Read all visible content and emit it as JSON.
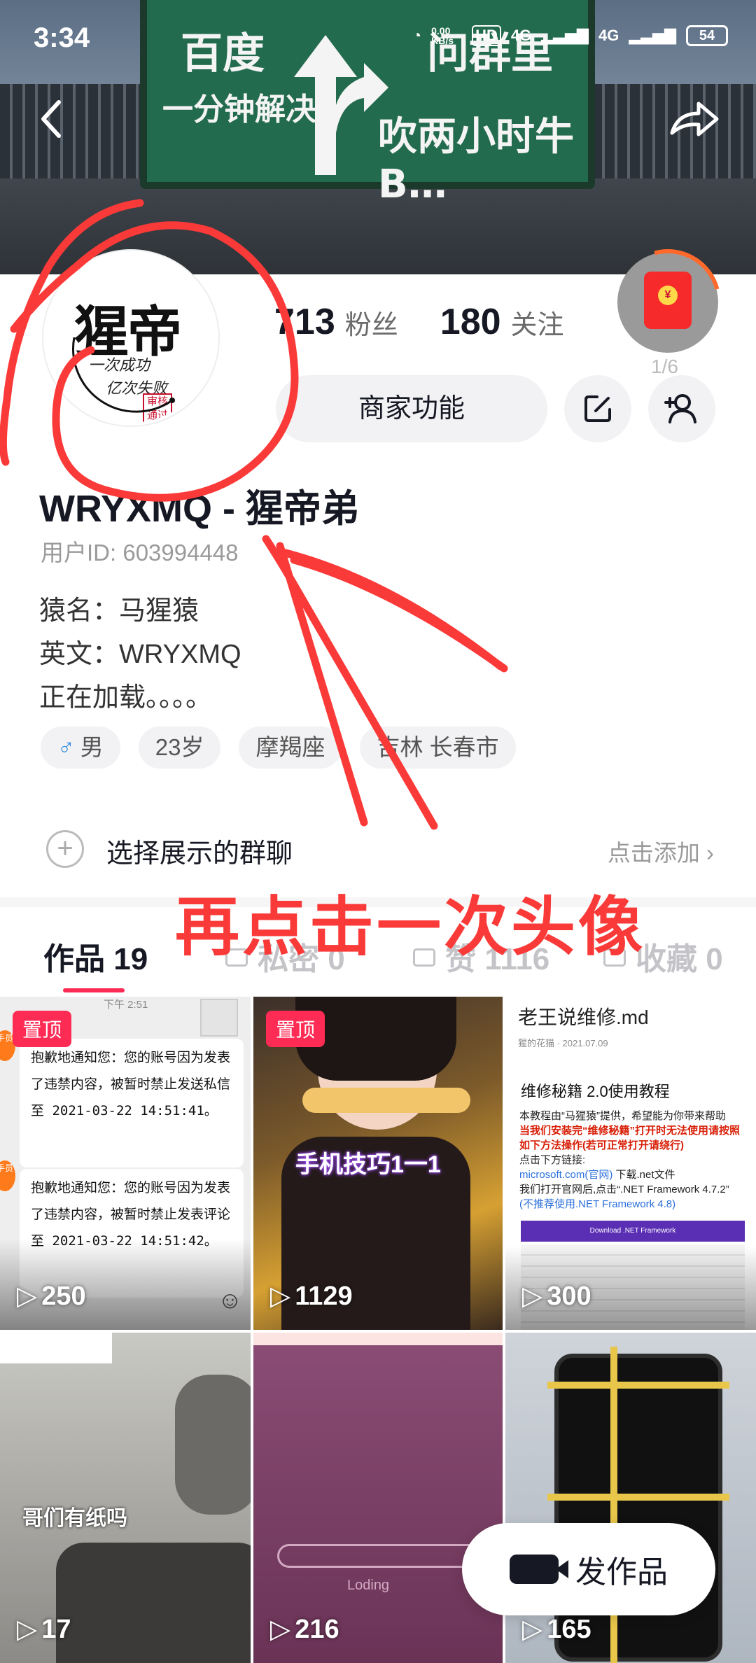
{
  "status_bar": {
    "time": "3:34",
    "net_speed": "0.00 KB/s",
    "hd": "HD",
    "signal1": "4G",
    "signal2": "4G",
    "battery": "54"
  },
  "banner": {
    "sign_left_1": "百度",
    "sign_left_2": "一分钟解决",
    "sign_right_1": "问群里",
    "sign_right_2": "吹两小时牛B…"
  },
  "avatar": {
    "title": "猩帝",
    "sub1": "一次成功",
    "sub2": "亿次失败",
    "seal": "审核通过"
  },
  "stats": {
    "followers_num": "713",
    "followers_label": "粉丝",
    "following_num": "180",
    "following_label": "关注"
  },
  "red_packet": {
    "count": "1/6",
    "coin": "¥"
  },
  "merchant_button": "商家功能",
  "profile": {
    "name": "WRYXMQ - 猩帝弟",
    "uid": "用户ID: 603994448",
    "bio": [
      "猿名：马猩猿",
      "英文：WRYXMQ",
      "正在加载。。。。"
    ]
  },
  "tags": [
    {
      "icon": "♂",
      "text": "男"
    },
    {
      "text": "23岁"
    },
    {
      "text": "摩羯座"
    },
    {
      "text": "吉林 长春市"
    }
  ],
  "group": {
    "label": "选择展示的群聊",
    "action": "点击添加"
  },
  "tabs": [
    {
      "label": "作品",
      "count": "19"
    },
    {
      "label": "私密",
      "count": "0"
    },
    {
      "label": "赞",
      "count": "1116"
    },
    {
      "label": "收藏",
      "count": "0"
    }
  ],
  "annotation": "再点击一次头像",
  "videos": [
    {
      "pinned": "置顶",
      "views": "250",
      "time": "下午 2:51",
      "notice1": "抱歉地通知您：您的账号因为发表了违禁内容，被暂时禁止发送私信至 2021-03-22 14:51:41。",
      "notice2": "抱歉地通知您：您的账号因为发表了违禁内容，被暂时禁止发表评论至 2021-03-22 14:51:42。",
      "badge": "手员"
    },
    {
      "pinned": "置顶",
      "views": "1129",
      "caption": "手机技巧1一1"
    },
    {
      "views": "300",
      "doc_title": "老王说维修.md",
      "doc_meta": "猩的花猫  ·  2021.07.09",
      "doc_heading": "维修秘籍 2.0使用教程",
      "doc_intro": "本教程由“马猩猿”提供，希望能为你带来帮助",
      "doc_red": "当我们安装完“维修秘籍”打开时无法使用请按照如下方法操作(若可正常打开请绕行)",
      "doc_line1": "点击下方链接:",
      "doc_link": "microsoft.com(官网)",
      "doc_line2": " 下载.net文件",
      "doc_line3": "我们打开官网后,点击“.NET Framework 4.7.2”",
      "doc_line4": "(不推荐使用.NET Framework 4.8)",
      "doc_bar": "Download .NET Framework"
    },
    {
      "views": "17",
      "caption": "哥们有纸吗"
    },
    {
      "views": "216",
      "caption": "Loding"
    },
    {
      "views": "165"
    }
  ],
  "fab_label": "发作品",
  "colors": {
    "accent": "#fe2c55",
    "annotation_red": "#fa3a38",
    "sign_green": "#236b4e"
  }
}
